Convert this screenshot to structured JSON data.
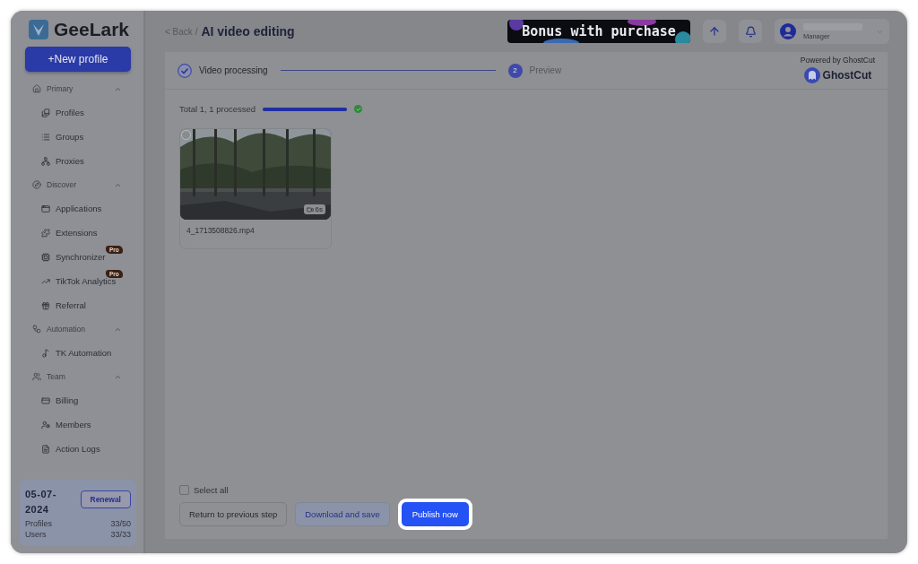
{
  "brand": {
    "name": "GeeLark"
  },
  "new_profile_button": "+New profile",
  "nav": [
    {
      "label": "Primary",
      "expanded": true,
      "children": [
        {
          "label": "Profiles"
        },
        {
          "label": "Groups"
        },
        {
          "label": "Proxies"
        }
      ]
    },
    {
      "label": "Discover",
      "expanded": true,
      "children": [
        {
          "label": "Applications"
        },
        {
          "label": "Extensions"
        },
        {
          "label": "Synchronizer",
          "badge": "Pro"
        },
        {
          "label": "TikTok Analytics",
          "badge": "Pro"
        },
        {
          "label": "Referral"
        }
      ]
    },
    {
      "label": "Automation",
      "expanded": true,
      "children": [
        {
          "label": "TK Automation"
        }
      ]
    },
    {
      "label": "Team",
      "expanded": true,
      "children": [
        {
          "label": "Billing"
        },
        {
          "label": "Members"
        },
        {
          "label": "Action Logs"
        }
      ]
    }
  ],
  "plan": {
    "date": "05-07-2024",
    "renewal_button": "Renewal",
    "stats": [
      {
        "label": "Profiles",
        "value": "33/50"
      },
      {
        "label": "Users",
        "value": "33/33"
      }
    ]
  },
  "header": {
    "back": "< Back /",
    "title": "AI video editing",
    "banner": "Bonus with purchase",
    "user_role": "Manager"
  },
  "steps": [
    {
      "label": "Video processing",
      "completed": true
    },
    {
      "label": "Preview",
      "number": "2",
      "completed": false
    }
  ],
  "powered_by": {
    "text": "Powered by GhostCut",
    "logo": "GhostCut"
  },
  "progress": {
    "label": "Total 1, 1 processed",
    "level": 1,
    "done": true
  },
  "videos": [
    {
      "kind": "picture",
      "selected": false,
      "duration": "6s",
      "filename": "4_1713508826.mp4"
    }
  ],
  "select_all": {
    "label": "Select all",
    "checked": false
  },
  "buttons": [
    {
      "label": "Return to previous step",
      "kind": "outline"
    },
    {
      "label": "Download and save",
      "kind": "soft"
    },
    {
      "label": "Publish now",
      "kind": "primary"
    }
  ]
}
